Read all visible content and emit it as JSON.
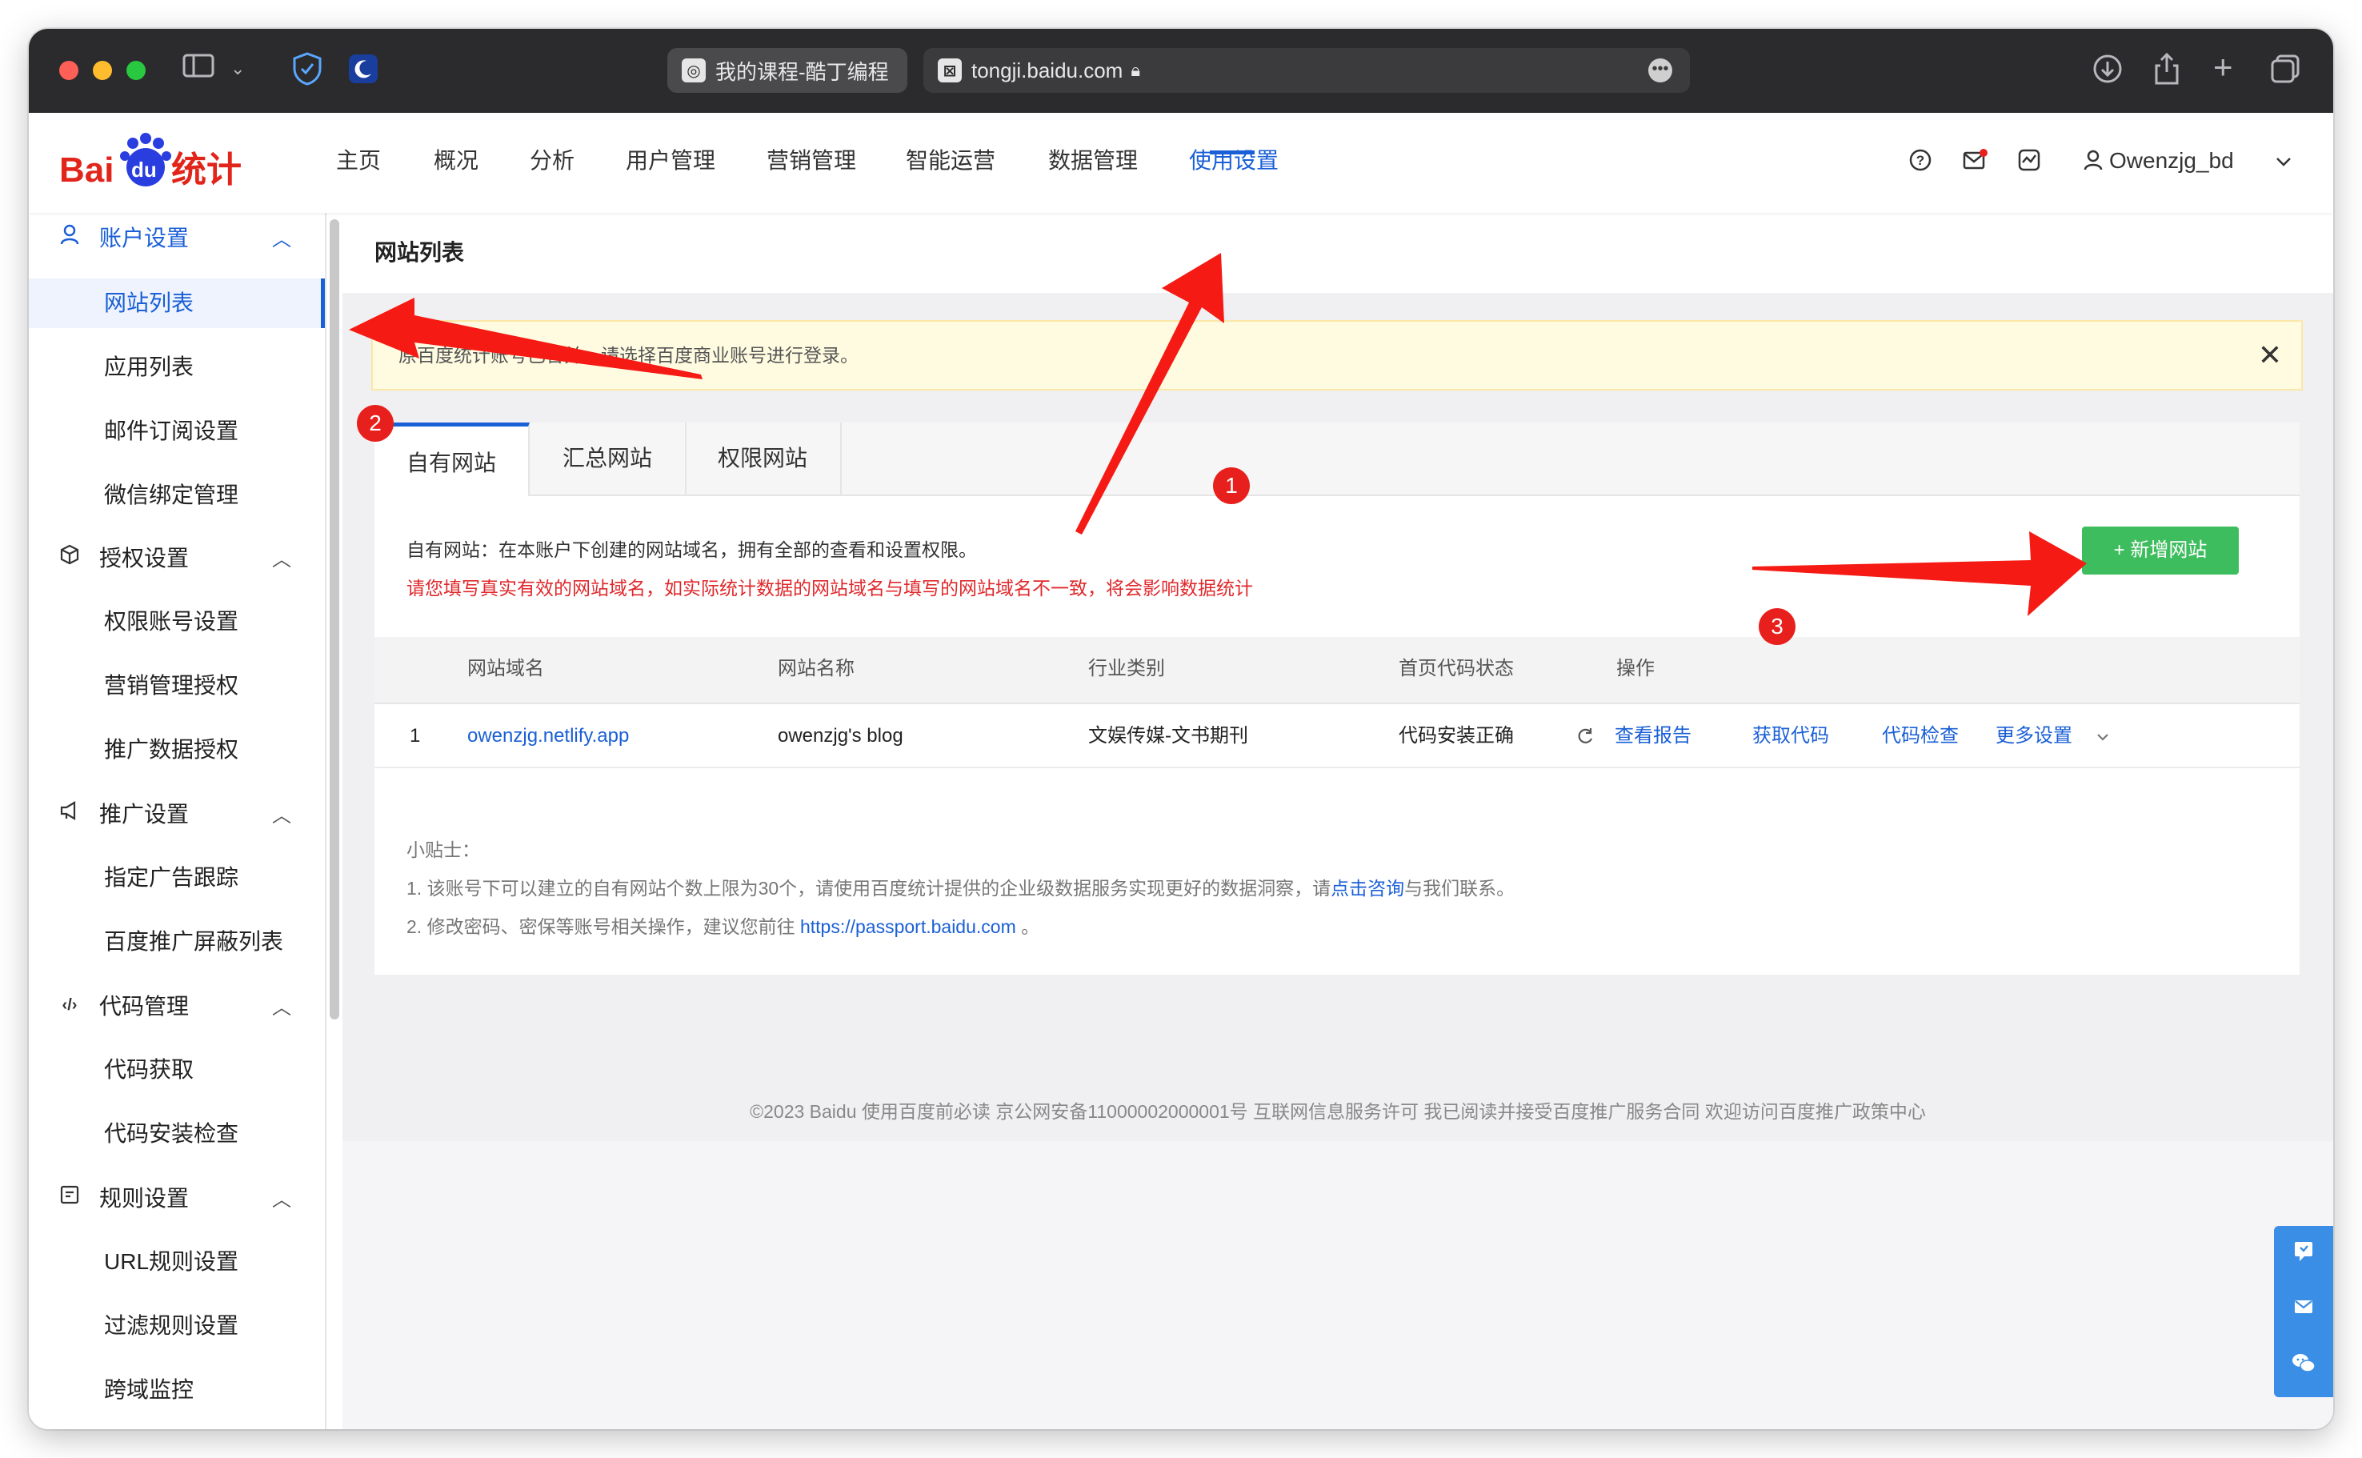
{
  "browser": {
    "tab_active": "我的课程-酷丁编程",
    "address": "tongji.baidu.com"
  },
  "header": {
    "logo_text": "Bai du 统计",
    "nav": [
      "主页",
      "概况",
      "分析",
      "用户管理",
      "营销管理",
      "智能运营",
      "数据管理",
      "使用设置"
    ],
    "active_nav": "使用设置",
    "user": "Owenzjg_bd"
  },
  "sidebar": {
    "groups": [
      {
        "label": "账户设置",
        "icon": "user-icon",
        "items": [
          "网站列表",
          "应用列表",
          "邮件订阅设置",
          "微信绑定管理"
        ]
      },
      {
        "label": "授权设置",
        "icon": "cube-icon",
        "items": [
          "权限账号设置",
          "营销管理授权",
          "推广数据授权"
        ]
      },
      {
        "label": "推广设置",
        "icon": "megaphone-icon",
        "items": [
          "指定广告跟踪",
          "百度推广屏蔽列表"
        ]
      },
      {
        "label": "代码管理",
        "icon": "code-icon",
        "items": [
          "代码获取",
          "代码安装检查"
        ]
      },
      {
        "label": "规则设置",
        "icon": "rules-icon",
        "items": [
          "URL规则设置",
          "过滤规则设置",
          "跨域监控"
        ]
      }
    ],
    "active_item": "网站列表"
  },
  "main": {
    "page_title": "网站列表",
    "notice": "原百度统计账号已合并，请选择百度商业账号进行登录。",
    "tabs": [
      "自有网站",
      "汇总网站",
      "权限网站"
    ],
    "desc1": "自有网站：在本账户下创建的网站域名，拥有全部的查看和设置权限。",
    "desc2": "请您填写真实有效的网站域名，如实际统计数据的网站域名与填写的网站域名不一致，将会影响数据统计",
    "add_button": "+ 新增网站",
    "table": {
      "headers": [
        "网站域名",
        "网站名称",
        "行业类别",
        "首页代码状态",
        "操作"
      ],
      "rows": [
        {
          "index": "1",
          "domain": "owenzjg.netlify.app",
          "name": "owenzjg's blog",
          "industry": "文娱传媒-文书期刊",
          "status": "代码安装正确",
          "actions": [
            "查看报告",
            "获取代码",
            "代码检查",
            "更多设置"
          ]
        }
      ]
    },
    "tips_title": "小贴士：",
    "tip1_prefix": "1. 该账号下可以建立的自有网站个数上限为30个，请使用百度统计提供的企业级数据服务实现更好的数据洞察，请",
    "tip1_link": "点击咨询",
    "tip1_suffix": "与我们联系。",
    "tip2_prefix": "2. 修改密码、密保等账号相关操作，建议您前往 ",
    "tip2_link": "https://passport.baidu.com",
    "tip2_suffix": " 。"
  },
  "footer": "©2023 Baidu 使用百度前必读 京公网安备11000002000001号 互联网信息服务许可 我已阅读并接受百度推广服务合同 欢迎访问百度推广政策中心",
  "annotations": [
    "1",
    "2",
    "3"
  ],
  "colors": {
    "accent": "#1a5fd6",
    "success": "#3dbd5e",
    "warning": "#e0292c",
    "annotation": "#e8201d"
  }
}
